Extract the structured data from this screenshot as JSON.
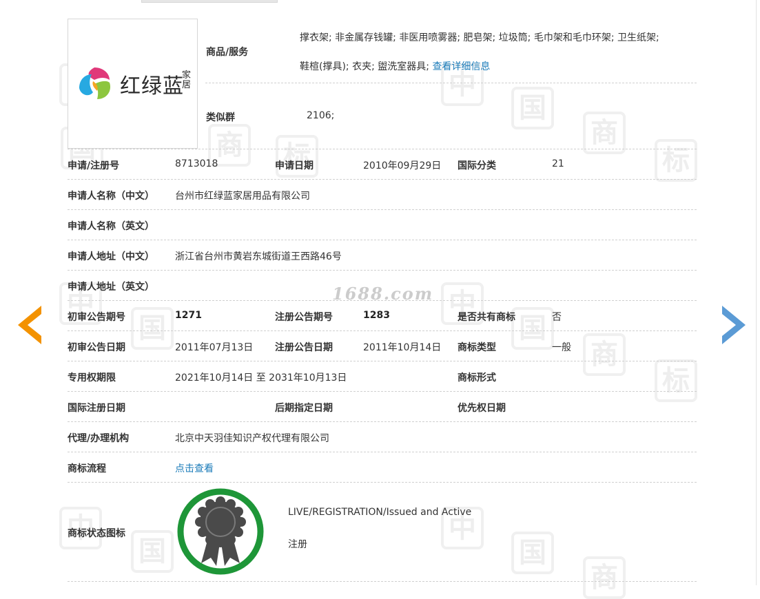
{
  "goods_services": {
    "label": "商品/服务",
    "line1": "撑衣架; 非金属存钱罐; 非医用喷雾器; 肥皂架; 垃圾筒; 毛巾架和毛巾环架; 卫生纸架;",
    "line2": "鞋楦(撑具); 衣夹; 盥洗室器具;",
    "detail_link": "查看详细信息"
  },
  "similar_group": {
    "label": "类似群",
    "value": "2106;"
  },
  "logo": {
    "text": "红绿蓝",
    "sub": "家居",
    "colors": [
      "#e0397a",
      "#27a9e1",
      "#8dc63f",
      "#f5a623"
    ]
  },
  "fields": {
    "reg_no_label": "申请/注册号",
    "reg_no": "8713018",
    "apply_date_label": "申请日期",
    "apply_date": "2010年09月29日",
    "intl_class_label": "国际分类",
    "intl_class": "21",
    "applicant_cn_label": "申请人名称（中文）",
    "applicant_cn": "台州市红绿蓝家居用品有限公司",
    "applicant_en_label": "申请人名称（英文）",
    "applicant_en": "",
    "address_cn_label": "申请人地址（中文）",
    "address_cn": "浙江省台州市黄岩东城街道王西路46号",
    "address_en_label": "申请人地址（英文）",
    "address_en": "",
    "prelim_no_label": "初审公告期号",
    "prelim_no": "1271",
    "reg_pub_no_label": "注册公告期号",
    "reg_pub_no": "1283",
    "shared_label": "是否共有商标",
    "shared": "否",
    "prelim_date_label": "初审公告日期",
    "prelim_date": "2011年07月13日",
    "reg_pub_date_label": "注册公告日期",
    "reg_pub_date": "2011年10月14日",
    "tm_type_label": "商标类型",
    "tm_type": "一般",
    "exclusive_label": "专用权期限",
    "exclusive": "2021年10月14日 至 2031年10月13日",
    "tm_form_label": "商标形式",
    "tm_form": "",
    "intl_reg_date_label": "国际注册日期",
    "intl_reg_date": "",
    "later_designation_label": "后期指定日期",
    "later_designation": "",
    "priority_date_label": "优先权日期",
    "priority_date": "",
    "agent_label": "代理/办理机构",
    "agent": "北京中天羽佳知识产权代理有限公司",
    "process_label": "商标流程",
    "process_link": "点击查看",
    "status_icon_label": "商标状态图标",
    "status_en": "LIVE/REGISTRATION/Issued and Active",
    "status_cn": "注册"
  },
  "watermark": "1688.com",
  "watermark_chars": [
    "中",
    "国",
    "商",
    "标"
  ],
  "colors": {
    "link": "#1a7bb9",
    "prev_arrow": "#f39200",
    "next_arrow": "#5b9bd5",
    "status_ring": "#1e9638",
    "badge": "#4a4a4a"
  }
}
